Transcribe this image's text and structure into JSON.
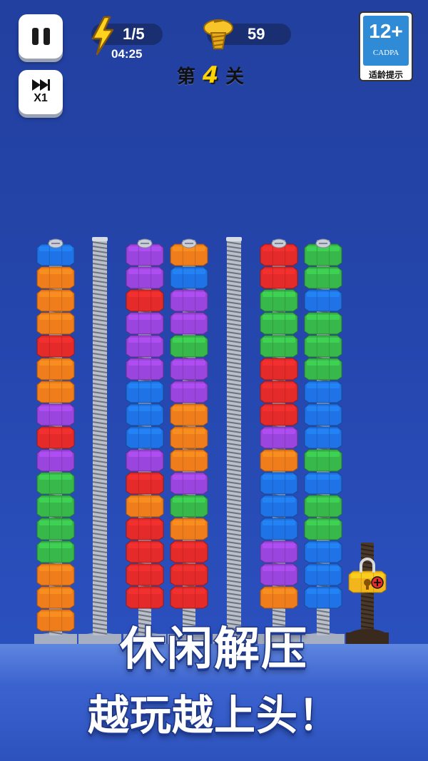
{
  "hud": {
    "energy": "1/5",
    "timer": "04:25",
    "coins": "59"
  },
  "level": {
    "prefix": "第",
    "number": "4",
    "suffix": "关"
  },
  "speed_label": "X1",
  "age_rating": {
    "label": "12+",
    "org": "CADPA",
    "tip": "适龄提示"
  },
  "slogan": {
    "line1": "休闲解压",
    "line2": "越玩越上头！"
  },
  "colors": {
    "blue": "#1f73e6",
    "orange": "#f07d1c",
    "red": "#e52a2a",
    "purple": "#9a45de",
    "green": "#38b84a",
    "yellow": "#f2b51b"
  },
  "columns": [
    {
      "type": "stack",
      "nuts": [
        "blue",
        "orange",
        "orange",
        "orange",
        "red",
        "orange",
        "orange",
        "purple",
        "red",
        "purple",
        "green",
        "green",
        "green",
        "green",
        "orange",
        "orange",
        "orange"
      ]
    },
    {
      "type": "empty"
    },
    {
      "type": "stack",
      "nuts": [
        "purple",
        "purple",
        "red",
        "purple",
        "purple",
        "purple",
        "blue",
        "blue",
        "blue",
        "purple",
        "red",
        "orange",
        "red",
        "red",
        "red",
        "red"
      ]
    },
    {
      "type": "stack",
      "nuts": [
        "orange",
        "blue",
        "purple",
        "purple",
        "green",
        "purple",
        "purple",
        "orange",
        "orange",
        "orange",
        "purple",
        "green",
        "orange",
        "red",
        "red",
        "red"
      ]
    },
    {
      "type": "empty"
    },
    {
      "type": "stack",
      "nuts": [
        "red",
        "red",
        "green",
        "green",
        "green",
        "red",
        "red",
        "red",
        "purple",
        "orange",
        "blue",
        "blue",
        "blue",
        "purple",
        "purple",
        "orange"
      ]
    },
    {
      "type": "stack",
      "nuts": [
        "green",
        "green",
        "blue",
        "green",
        "green",
        "green",
        "blue",
        "blue",
        "blue",
        "green",
        "blue",
        "green",
        "green",
        "blue",
        "blue",
        "blue"
      ]
    },
    {
      "type": "locked",
      "nuts": [
        "yellow"
      ]
    }
  ]
}
